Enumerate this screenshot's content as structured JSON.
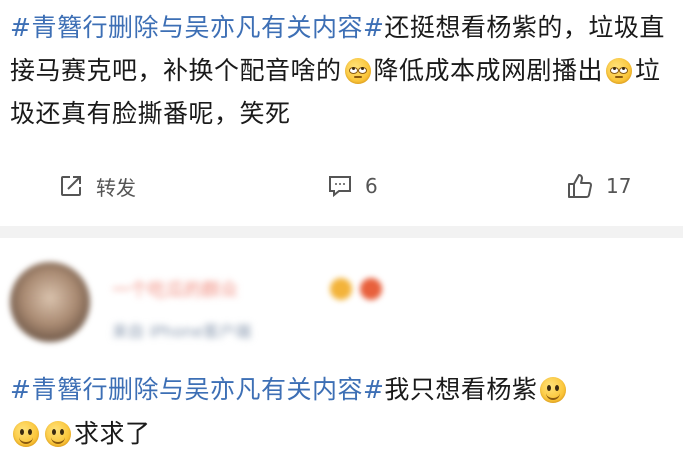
{
  "post": {
    "hashtag": "#青簪行删除与吴亦凡有关内容#",
    "text_1": "还挺想看杨紫的，垃圾直接马赛克吧，补换个配音啥的",
    "text_2": "降低成本成网剧播出",
    "text_3": "垃圾还真有脸撕番呢，笑死",
    "emoji_icon": "rolling-eyes-emoji"
  },
  "actions": {
    "repost_label": "转发",
    "comment_count": "6",
    "like_count": "17"
  },
  "comment": {
    "username": "一个吃瓜的群众",
    "meta": "来自 iPhone客户端",
    "hashtag": "#青簪行删除与吴亦凡有关内容#",
    "text_1": "我只想看杨紫",
    "text_2": "求求了",
    "emoji_icon": "smile-emoji"
  }
}
